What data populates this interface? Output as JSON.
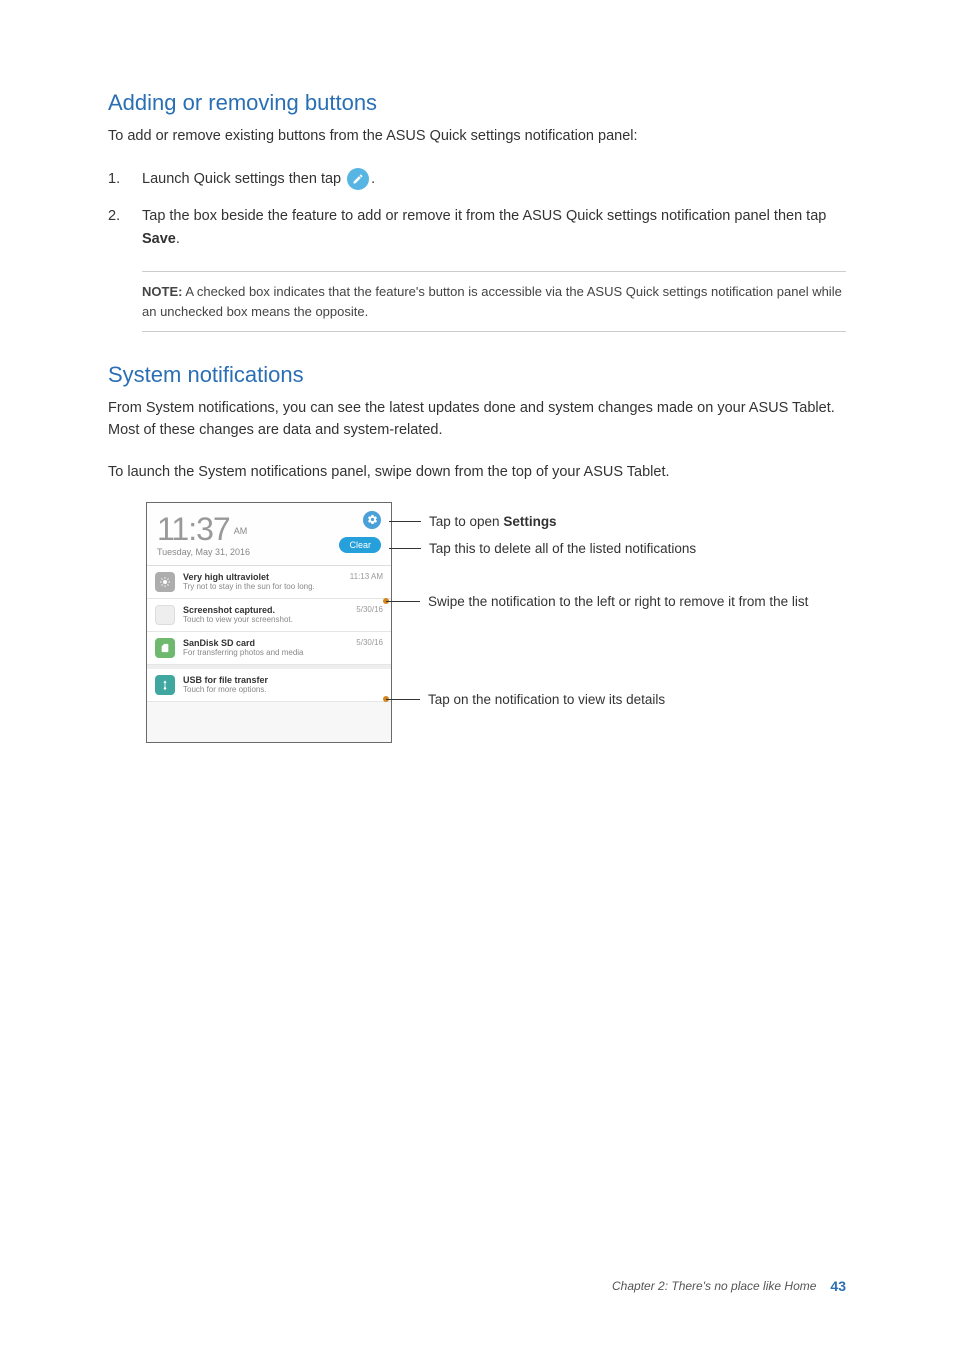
{
  "section1": {
    "heading": "Adding or removing buttons",
    "intro": "To add or remove existing buttons from the ASUS Quick settings notification panel:",
    "step1_num": "1.",
    "step1_a": "Launch Quick settings then tap ",
    "step1_b": ".",
    "step2_num": "2.",
    "step2_a": "Tap the box beside the feature to add or remove it from the ASUS Quick settings notification panel then tap ",
    "step2_save": "Save",
    "step2_b": ".",
    "note_label": "NOTE:",
    "note_text": " A checked box indicates that the feature's button is accessible via the ASUS Quick settings notification panel while an unchecked box means the opposite."
  },
  "section2": {
    "heading": "System notifications",
    "p1": "From System notifications, you can see the latest updates done and system changes made on your ASUS Tablet. Most of these changes are data and system-related.",
    "p2": "To launch the System notifications panel, swipe down from the top of your ASUS Tablet."
  },
  "panel": {
    "time": "11:37",
    "ampm": "AM",
    "date": "Tuesday, May 31, 2016",
    "clear": "Clear",
    "items": [
      {
        "title": "Very high ultraviolet",
        "sub": "Try not to stay in the sun for too long.",
        "time": "11:13 AM"
      },
      {
        "title": "Screenshot captured.",
        "sub": "Touch to view your screenshot.",
        "time": "5/30/16"
      },
      {
        "title": "SanDisk SD card",
        "sub": "For transferring photos and media",
        "time": "5/30/16"
      },
      {
        "title": "USB for file transfer",
        "sub": "Touch for more options.",
        "time": ""
      }
    ]
  },
  "callouts": {
    "settings_a": "Tap to open ",
    "settings_b": "Settings",
    "clear": "Tap this to delete all of the listed notifications",
    "swipe": "Swipe the notification to the left or right to remove it from the list",
    "detail": "Tap on the notification to view its details"
  },
  "footer": {
    "chapter": "Chapter 2: There's no place like Home",
    "page": "43"
  }
}
